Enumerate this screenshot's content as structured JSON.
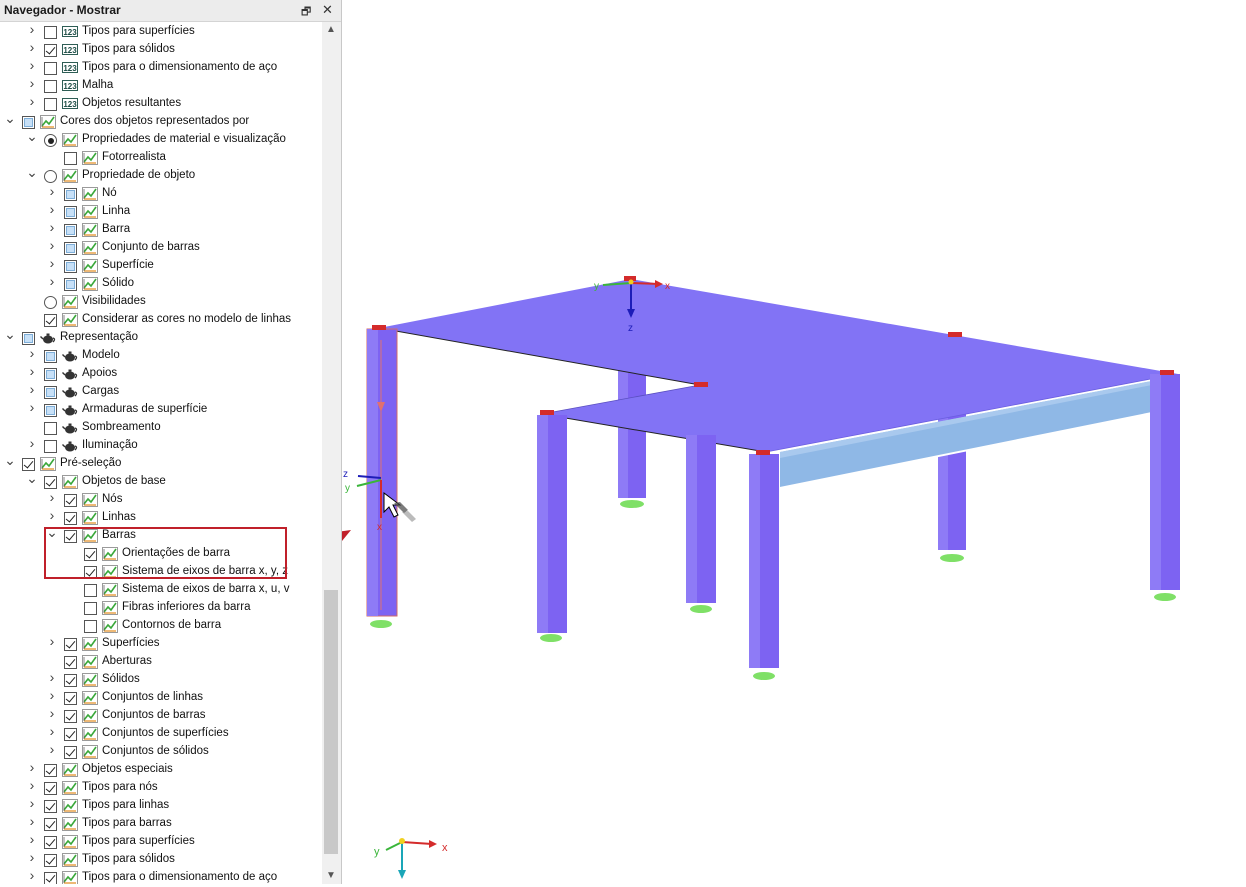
{
  "panel": {
    "title": "Navegador - Mostrar",
    "pin_icon": "pin-icon",
    "close_icon": "close-icon"
  },
  "tree": [
    {
      "label": "Tipos para superfícies",
      "chev": "right",
      "check": "unchecked",
      "icon": "i123",
      "level": 2
    },
    {
      "label": "Tipos para sólidos",
      "chev": "right",
      "check": "checked",
      "icon": "i123",
      "level": 2
    },
    {
      "label": "Tipos para o dimensionamento de aço",
      "chev": "right",
      "check": "unchecked",
      "icon": "i123",
      "level": 2
    },
    {
      "label": "Malha",
      "chev": "right",
      "check": "unchecked",
      "icon": "i123",
      "level": 2
    },
    {
      "label": "Objetos resultantes",
      "chev": "right",
      "check": "unchecked",
      "icon": "i123",
      "level": 2
    },
    {
      "label": "Cores dos objetos representados por",
      "chev": "down",
      "check": "partial",
      "icon": "chart",
      "level": 1
    },
    {
      "label": "Propriedades de material e visualização",
      "chev": "down",
      "check": "radio-on",
      "icon": "chart",
      "level": 2
    },
    {
      "label": "Fotorrealista",
      "chev": "",
      "check": "unchecked",
      "icon": "chart",
      "level": 3
    },
    {
      "label": "Propriedade de objeto",
      "chev": "down",
      "check": "radio-off",
      "icon": "chart",
      "level": 2
    },
    {
      "label": "Nó",
      "chev": "right",
      "check": "partial",
      "icon": "chart",
      "level": 3
    },
    {
      "label": "Linha",
      "chev": "right",
      "check": "partial",
      "icon": "chart",
      "level": 3
    },
    {
      "label": "Barra",
      "chev": "right",
      "check": "partial",
      "icon": "chart",
      "level": 3
    },
    {
      "label": "Conjunto de barras",
      "chev": "right",
      "check": "partial",
      "icon": "chart",
      "level": 3
    },
    {
      "label": "Superfície",
      "chev": "right",
      "check": "partial",
      "icon": "chart",
      "level": 3
    },
    {
      "label": "Sólido",
      "chev": "right",
      "check": "partial",
      "icon": "chart",
      "level": 3
    },
    {
      "label": "Visibilidades",
      "chev": "",
      "check": "radio-off",
      "icon": "chart",
      "level": 2
    },
    {
      "label": "Considerar as cores no modelo de linhas",
      "chev": "",
      "check": "checked",
      "icon": "chart",
      "level": 2
    },
    {
      "label": "Representação",
      "chev": "down",
      "check": "partial",
      "icon": "teapot",
      "level": 1
    },
    {
      "label": "Modelo",
      "chev": "right",
      "check": "partial",
      "icon": "teapot",
      "level": 2
    },
    {
      "label": "Apoios",
      "chev": "right",
      "check": "partial",
      "icon": "teapot",
      "level": 2
    },
    {
      "label": "Cargas",
      "chev": "right",
      "check": "partial",
      "icon": "teapot",
      "level": 2
    },
    {
      "label": "Armaduras de superfície",
      "chev": "right",
      "check": "partial",
      "icon": "teapot",
      "level": 2
    },
    {
      "label": "Sombreamento",
      "chev": "",
      "check": "unchecked",
      "icon": "teapot",
      "level": 2
    },
    {
      "label": "Iluminação",
      "chev": "right",
      "check": "unchecked",
      "icon": "teapot",
      "level": 2
    },
    {
      "label": "Pré-seleção",
      "chev": "down",
      "check": "checked",
      "icon": "chart",
      "level": 1
    },
    {
      "label": "Objetos de base",
      "chev": "down",
      "check": "checked",
      "icon": "chart",
      "level": 2
    },
    {
      "label": "Nós",
      "chev": "right",
      "check": "checked",
      "icon": "chart",
      "level": 3
    },
    {
      "label": "Linhas",
      "chev": "right",
      "check": "checked",
      "icon": "chart",
      "level": 3
    },
    {
      "label": "Barras",
      "chev": "down",
      "check": "checked",
      "icon": "chart",
      "level": 3
    },
    {
      "label": "Orientações de barra",
      "chev": "",
      "check": "checked",
      "icon": "chart",
      "level": 4
    },
    {
      "label": "Sistema de eixos de barra x, y, z",
      "chev": "",
      "check": "checked",
      "icon": "chart",
      "level": 4
    },
    {
      "label": "Sistema de eixos de barra x, u, v",
      "chev": "",
      "check": "unchecked",
      "icon": "chart",
      "level": 4
    },
    {
      "label": "Fibras inferiores da barra",
      "chev": "",
      "check": "unchecked",
      "icon": "chart",
      "level": 4
    },
    {
      "label": "Contornos de barra",
      "chev": "",
      "check": "unchecked",
      "icon": "chart",
      "level": 4
    },
    {
      "label": "Superfícies",
      "chev": "right",
      "check": "checked",
      "icon": "chart",
      "level": 3
    },
    {
      "label": "Aberturas",
      "chev": "",
      "check": "checked",
      "icon": "chart",
      "level": 3
    },
    {
      "label": "Sólidos",
      "chev": "right",
      "check": "checked",
      "icon": "chart",
      "level": 3
    },
    {
      "label": "Conjuntos de linhas",
      "chev": "right",
      "check": "checked",
      "icon": "chart",
      "level": 3
    },
    {
      "label": "Conjuntos de barras",
      "chev": "right",
      "check": "checked",
      "icon": "chart",
      "level": 3
    },
    {
      "label": "Conjuntos de superfícies",
      "chev": "right",
      "check": "checked",
      "icon": "chart",
      "level": 3
    },
    {
      "label": "Conjuntos de sólidos",
      "chev": "right",
      "check": "checked",
      "icon": "chart",
      "level": 3
    },
    {
      "label": "Objetos especiais",
      "chev": "right",
      "check": "checked",
      "icon": "chart",
      "level": 2
    },
    {
      "label": "Tipos para nós",
      "chev": "right",
      "check": "checked",
      "icon": "chart",
      "level": 2
    },
    {
      "label": "Tipos para linhas",
      "chev": "right",
      "check": "checked",
      "icon": "chart",
      "level": 2
    },
    {
      "label": "Tipos para barras",
      "chev": "right",
      "check": "checked",
      "icon": "chart",
      "level": 2
    },
    {
      "label": "Tipos para superfícies",
      "chev": "right",
      "check": "checked",
      "icon": "chart",
      "level": 2
    },
    {
      "label": "Tipos para sólidos",
      "chev": "right",
      "check": "checked",
      "icon": "chart",
      "level": 2
    },
    {
      "label": "Tipos para o dimensionamento de aço",
      "chev": "right",
      "check": "checked",
      "icon": "chart",
      "level": 2
    }
  ],
  "viewport": {
    "axis_labels": {
      "x": "x",
      "y": "y",
      "z": "z"
    },
    "colors": {
      "slab": "#8273f5",
      "column": "#7d63f2",
      "beam": "#8fb8e6",
      "support": "#7fe067",
      "axis_x": "#d42b2b",
      "axis_y": "#3ab53a",
      "axis_z": "#1d1db8",
      "callout": "#c0202a"
    }
  }
}
